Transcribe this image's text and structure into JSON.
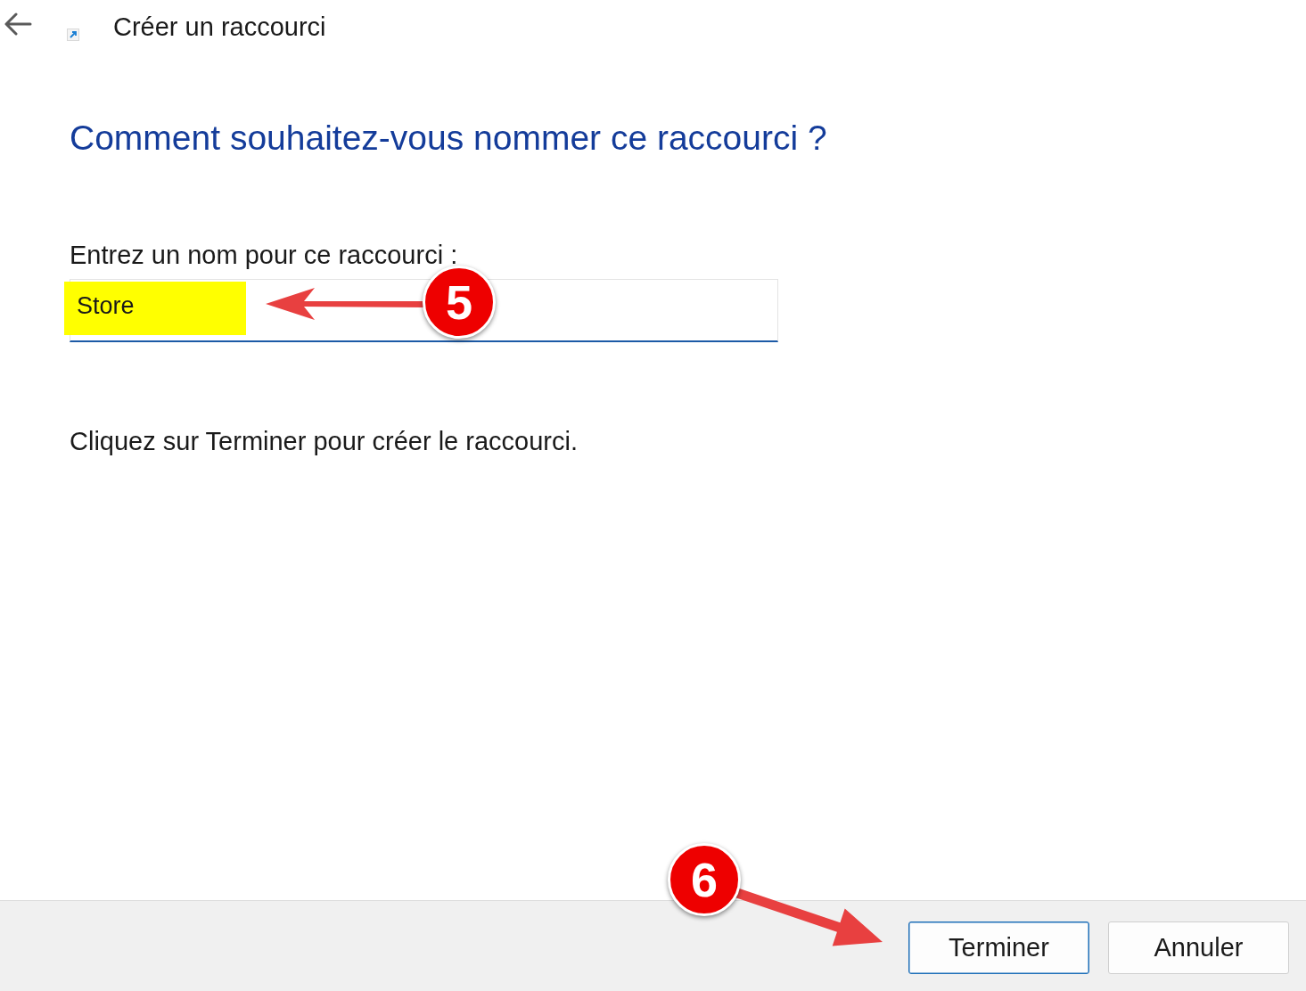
{
  "window": {
    "title": "Créer un raccourci"
  },
  "heading": "Comment souhaitez-vous nommer ce raccourci ?",
  "name_field": {
    "label": "Entrez un nom pour ce raccourci :",
    "value": "Store",
    "highlighted": true,
    "annotation": {
      "label": "5"
    }
  },
  "instruction": "Cliquez sur Terminer pour créer le raccourci.",
  "footer": {
    "buttons": [
      {
        "label": "Terminer",
        "default": true
      },
      {
        "label": "Annuler",
        "default": false
      }
    ],
    "annotation": {
      "label": "6"
    }
  }
}
